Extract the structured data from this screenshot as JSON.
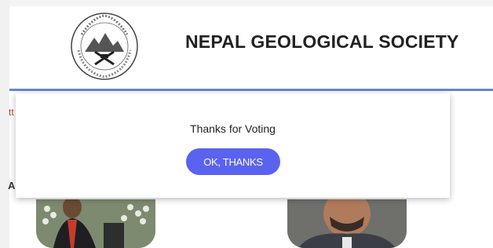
{
  "header": {
    "title": "NEPAL GEOLOGICAL SOCIETY",
    "logo_icon": "society-seal-icon"
  },
  "modal": {
    "message": "Thanks for Voting",
    "ok_label": "OK, THANKS"
  },
  "colors": {
    "button": "#5a63f0",
    "header_line": "#6a86c8",
    "fragment_text": "#c0392b"
  },
  "fragments": {
    "left_red": "tt",
    "left_a": "A"
  },
  "candidates": [
    {
      "photo_icon": "candidate-photo"
    },
    {
      "photo_icon": "candidate-photo"
    }
  ]
}
